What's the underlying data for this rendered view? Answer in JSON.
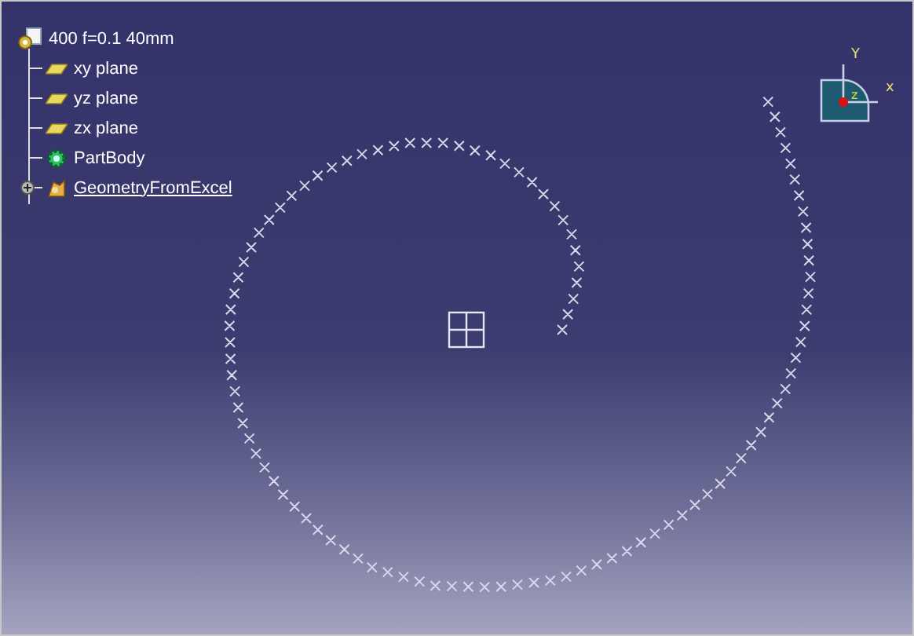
{
  "tree": {
    "root": {
      "label": "400 f=0.1 40mm"
    },
    "children": [
      {
        "label": "xy plane",
        "kind": "plane",
        "expandable": false,
        "in_work": false
      },
      {
        "label": "yz plane",
        "kind": "plane",
        "expandable": false,
        "in_work": false
      },
      {
        "label": "zx plane",
        "kind": "plane",
        "expandable": false,
        "in_work": false
      },
      {
        "label": "PartBody",
        "kind": "body",
        "expandable": false,
        "in_work": false
      },
      {
        "label": "GeometryFromExcel",
        "kind": "geometry",
        "expandable": true,
        "in_work": true
      }
    ]
  },
  "compass": {
    "y_label": "Y",
    "x_label": "x",
    "z_label": "z"
  }
}
